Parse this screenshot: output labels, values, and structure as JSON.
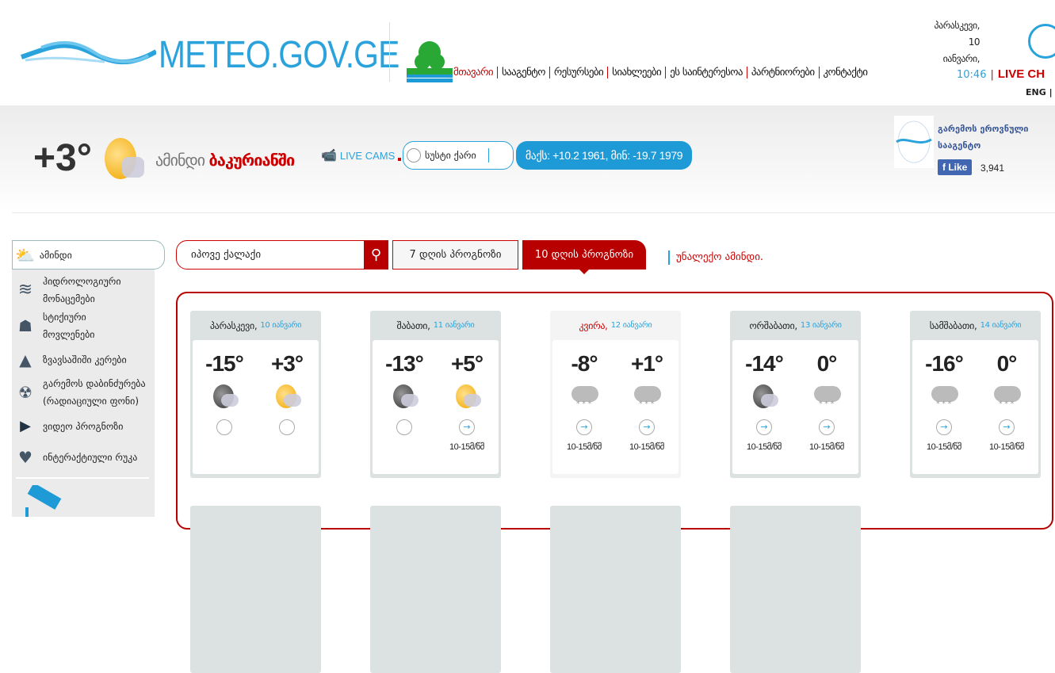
{
  "logo": {
    "text": "METEO.GOV.GE"
  },
  "nav": [
    "მთავარი",
    "სააგენტო",
    "რესურსები",
    "სიახლეები",
    "ეს საინტერესოა",
    "პარტნიორები",
    "კონტაქტი"
  ],
  "datebox": {
    "day": "პარასკევი,",
    "num": "10",
    "month": "იანვარი,",
    "time": "10:46",
    "live": "LIVE CH",
    "lang": "ENG |"
  },
  "current": {
    "temp": "+3°",
    "title": "ამინდი",
    "city": "ბაკურიანში",
    "cams": "LIVE CAMS",
    "wind": "სუსტი ქარი",
    "records": "მაქს: +10.2 1961, მინ: -19.7 1979"
  },
  "facebook": {
    "name": "გარემოს ეროვნული სააგენტო",
    "like": "Like",
    "count": "3,941"
  },
  "sidebar": {
    "items": [
      "ამინდი",
      "ჰიდროლოგიური მონაცემები",
      "სტიქიური მოვლენები",
      "ზვავსაშიში კერები",
      "გარემოს დაბინძურება (რადიაციული ფონი)",
      "ვიდეო პროგნოზი",
      "ინტერაქტიული რუკა"
    ]
  },
  "search": {
    "placeholder": "იპოვე ქალაქი"
  },
  "tabs": {
    "seven": "7 დღის პროგნოზი",
    "ten": "10 დღის პროგნოზი",
    "nopre": "უნალექო ამინდი."
  },
  "colors": {
    "accent": "#b80000",
    "blue": "#2aa3dc"
  },
  "forecast": [
    {
      "day": "პარასკევი,",
      "date": "10 იანვარი",
      "night": "-15°",
      "dayt": "+3°",
      "icons": [
        "moon",
        "sun"
      ],
      "wind": [
        "",
        ""
      ]
    },
    {
      "day": "შაბათი,",
      "date": "11 იანვარი",
      "night": "-13°",
      "dayt": "+5°",
      "icons": [
        "moon",
        "sun"
      ],
      "wind": [
        "",
        "10-15მ/წმ"
      ]
    },
    {
      "day": "კვირა,",
      "date": "12 იანვარი",
      "night": "-8°",
      "dayt": "+1°",
      "icons": [
        "snow",
        "snow"
      ],
      "wind": [
        "10-15მ/წმ",
        "10-15მ/წმ"
      ],
      "selected": true
    },
    {
      "day": "ორშაბათი,",
      "date": "13 იანვარი",
      "night": "-14°",
      "dayt": "0°",
      "icons": [
        "moon",
        "snow"
      ],
      "wind": [
        "10-15მ/წმ",
        "10-15მ/წმ"
      ]
    },
    {
      "day": "სამშაბათი,",
      "date": "14 იანვარი",
      "night": "-16°",
      "dayt": "0°",
      "icons": [
        "snow",
        "snow"
      ],
      "wind": [
        "10-15მ/წმ",
        "10-15მ/წმ"
      ]
    }
  ]
}
